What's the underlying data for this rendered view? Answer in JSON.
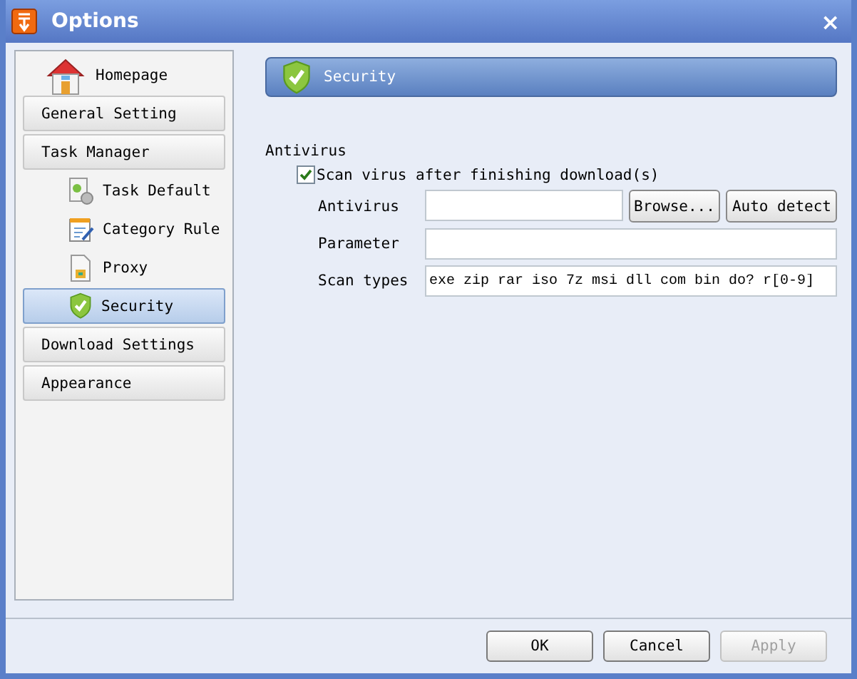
{
  "window": {
    "title": "Options",
    "close": "×"
  },
  "sidebar": {
    "items": [
      {
        "kind": "home",
        "label": "Homepage",
        "selected": false
      },
      {
        "kind": "category",
        "label": "General Setting",
        "selected": false
      },
      {
        "kind": "category",
        "label": "Task Manager",
        "selected": false,
        "children": [
          {
            "kind": "task",
            "label": "Task Default",
            "selected": false
          },
          {
            "kind": "rule",
            "label": "Category Rule",
            "selected": false
          },
          {
            "kind": "proxy",
            "label": "Proxy",
            "selected": false
          },
          {
            "kind": "security",
            "label": "Security",
            "selected": true
          }
        ]
      },
      {
        "kind": "category",
        "label": "Download Settings",
        "selected": false
      },
      {
        "kind": "category",
        "label": "Appearance",
        "selected": false
      }
    ]
  },
  "header": {
    "title": "Security"
  },
  "section": {
    "title": "Antivirus",
    "scan_after_download": {
      "label": "Scan virus after finishing download(s)",
      "checked": true
    },
    "fields": [
      {
        "label": "Antivirus",
        "buttons": [
          "Browse...",
          "Auto detect"
        ]
      },
      {
        "label": "Parameter"
      },
      {
        "label": "Scan types",
        "value": "exe zip rar iso 7z msi dll com bin do? r[0-9]"
      }
    ]
  },
  "buttons": [
    {
      "label": "OK",
      "disabled": false
    },
    {
      "label": "Cancel",
      "disabled": false
    },
    {
      "label": "Apply",
      "disabled": true
    }
  ]
}
